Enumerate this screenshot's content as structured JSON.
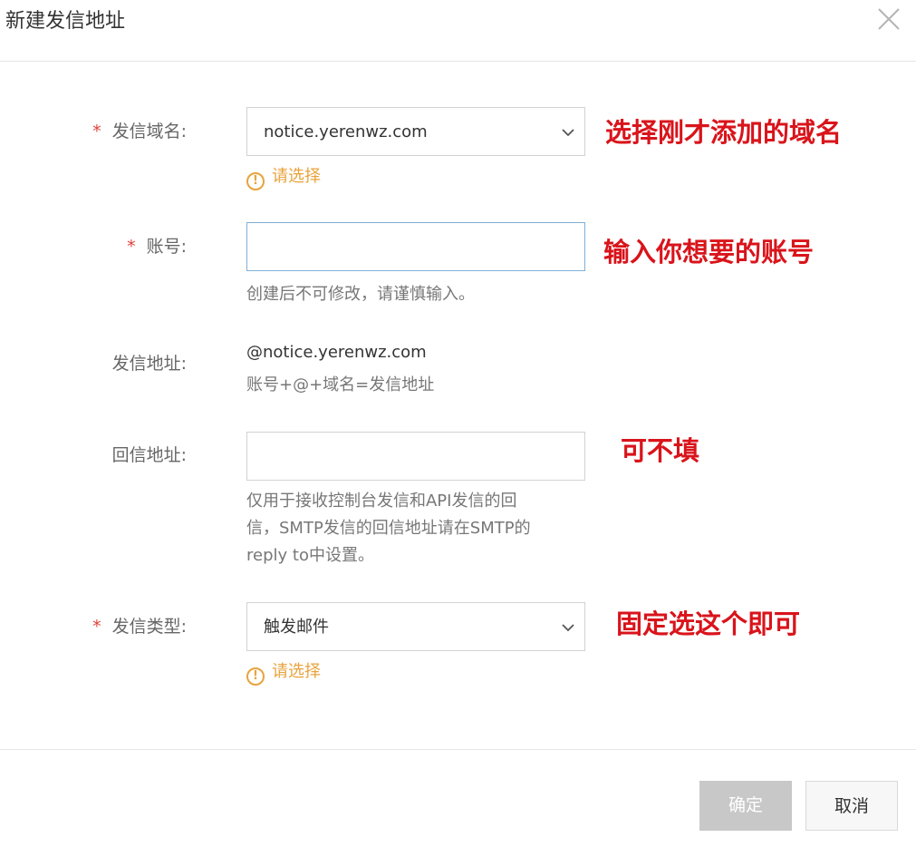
{
  "dialog": {
    "title": "新建发信地址"
  },
  "form": {
    "domain": {
      "label": "发信域名:",
      "value": "notice.yerenwz.com",
      "warning": "请选择"
    },
    "account": {
      "label": "账号:",
      "value": "",
      "hint": "创建后不可修改，请谨慎输入。"
    },
    "address": {
      "label": "发信地址:",
      "value": "@notice.yerenwz.com",
      "hint": "账号+@+域名=发信地址"
    },
    "reply": {
      "label": "回信地址:",
      "value": "",
      "hint_lines": [
        "仅用于接收控制台发信和API发信的回",
        "信，SMTP发信的回信地址请在SMTP的",
        "reply to中设置。"
      ]
    },
    "type": {
      "label": "发信类型:",
      "value": "触发邮件",
      "warning": "请选择"
    }
  },
  "annotations": {
    "domain": "选择刚才添加的域名",
    "account": "输入你想要的账号",
    "reply": "可不填",
    "type": "固定选这个即可"
  },
  "buttons": {
    "confirm": "确定",
    "cancel": "取消"
  },
  "icons": {
    "close": "close-icon",
    "dropdown": "chevron-down-icon",
    "warning": "exclamation-circle-icon"
  },
  "colors": {
    "required": "#e0423a",
    "warning": "#e8a33c",
    "annotation": "#d9141b",
    "focus_border": "#7fb0d6",
    "confirm_disabled": "#c8c8c8"
  }
}
